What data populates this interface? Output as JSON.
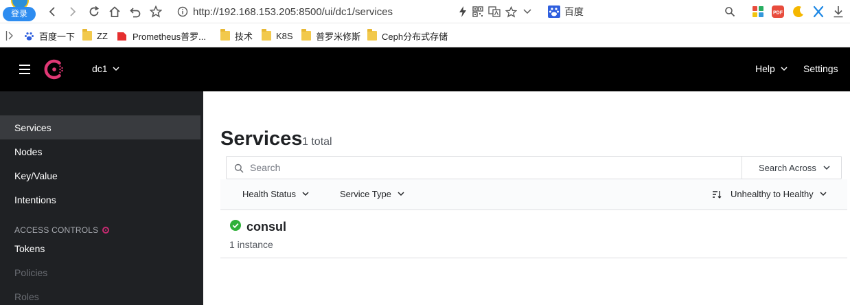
{
  "browser": {
    "login_badge": "登录",
    "url": "http://192.168.153.205:8500/ui/dc1/services",
    "search_engine": "百度",
    "bookmarks": [
      {
        "label": "百度一下",
        "icon": "baidu-paw-icon"
      },
      {
        "label": "ZZ",
        "icon": "folder-icon"
      },
      {
        "label": "Prometheus普罗...",
        "icon": "prometheus-icon"
      },
      {
        "label": "技术",
        "icon": "folder-icon"
      },
      {
        "label": "K8S",
        "icon": "folder-icon"
      },
      {
        "label": "普罗米修斯",
        "icon": "folder-icon"
      },
      {
        "label": "Ceph分布式存储",
        "icon": "folder-icon"
      }
    ]
  },
  "header": {
    "datacenter": "dc1",
    "help": "Help",
    "settings": "Settings"
  },
  "sidebar": {
    "items": [
      {
        "label": "Services",
        "active": true
      },
      {
        "label": "Nodes"
      },
      {
        "label": "Key/Value"
      },
      {
        "label": "Intentions"
      }
    ],
    "section_title": "ACCESS CONTROLS",
    "acl_items": [
      {
        "label": "Tokens",
        "enabled": true
      },
      {
        "label": "Policies",
        "enabled": false
      },
      {
        "label": "Roles",
        "enabled": false
      }
    ]
  },
  "main": {
    "title": "Services",
    "count": "1 total",
    "search_placeholder": "Search",
    "search_across": "Search Across",
    "filters": {
      "health_status": "Health Status",
      "service_type": "Service Type",
      "sort": "Unhealthy to Healthy"
    },
    "services": [
      {
        "name": "consul",
        "instances": "1 instance",
        "status": "passing"
      }
    ]
  },
  "colors": {
    "header_bg": "#000000",
    "sidebar_bg": "#1f2124",
    "consul_brand": "#e03875",
    "health_passing": "#2eb039",
    "acl_dot": "#c62a71"
  }
}
